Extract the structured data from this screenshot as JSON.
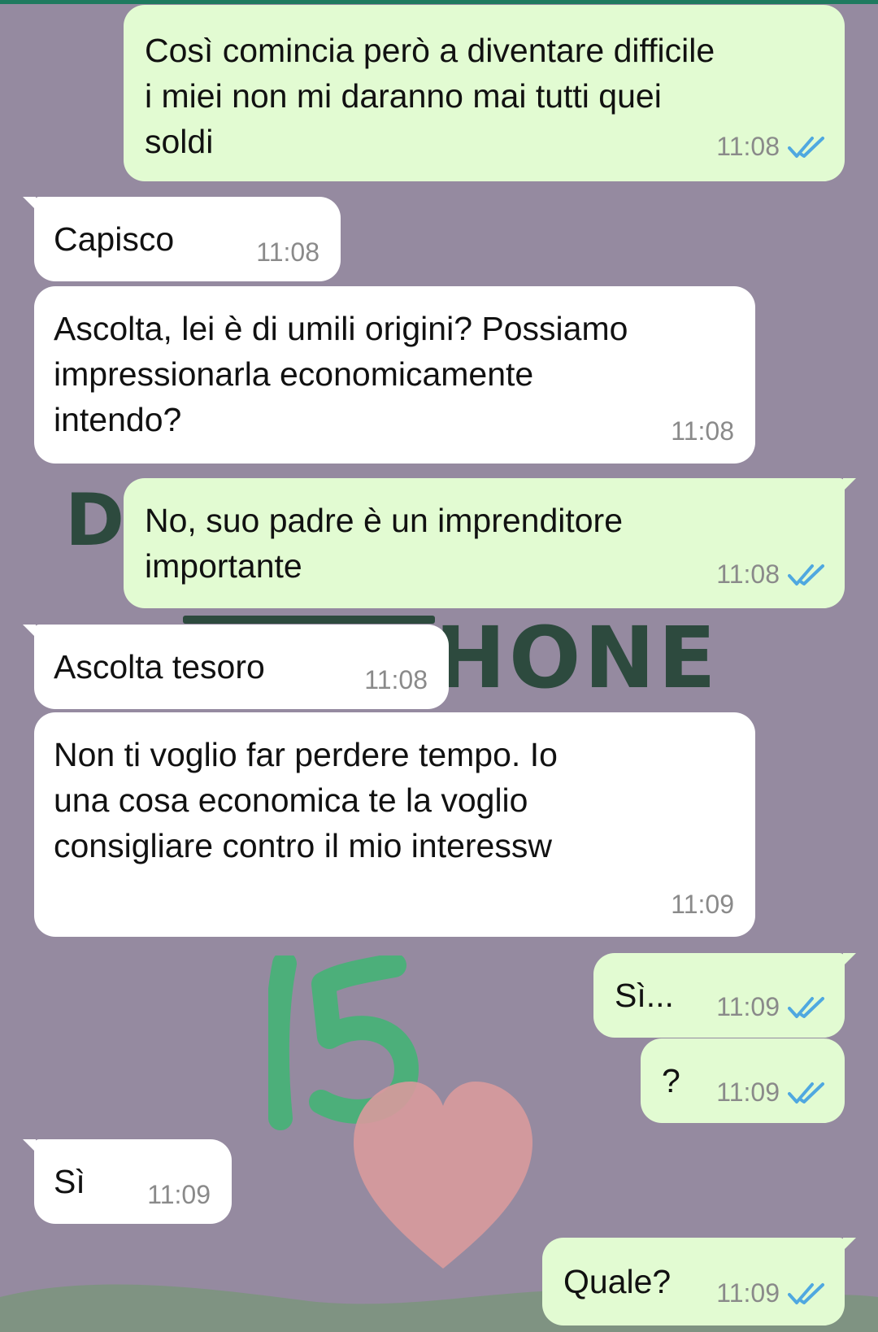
{
  "colors": {
    "wallpaper": "#958aa0",
    "incoming_bubble": "#ffffff",
    "outgoing_bubble": "#e2fbd2",
    "read_tick": "#4fa8e0",
    "timestamp": "#8a8a8a",
    "wallpaper_text": "#2d4a3e",
    "sticker_green": "#4caf7a",
    "heart_pink": "#d89a9c"
  },
  "wallpaper": {
    "letter": "D",
    "word": "HONE"
  },
  "messages": [
    {
      "direction": "outgoing",
      "lines": [
        "Così comincia però a diventare difficile",
        "i miei non mi daranno mai tutti quei",
        "soldi"
      ],
      "time": "11:08",
      "status": "read"
    },
    {
      "direction": "incoming",
      "lines": [
        "Capisco"
      ],
      "time": "11:08"
    },
    {
      "direction": "incoming",
      "lines": [
        "Ascolta, lei è di umili origini? Possiamo",
        "impressionarla economicamente",
        "intendo?"
      ],
      "time": "11:08"
    },
    {
      "direction": "outgoing",
      "lines": [
        "No, suo padre è un imprenditore",
        "importante"
      ],
      "time": "11:08",
      "status": "read"
    },
    {
      "direction": "incoming",
      "lines": [
        "Ascolta tesoro"
      ],
      "time": "11:08"
    },
    {
      "direction": "incoming",
      "lines": [
        "Non ti voglio far perdere tempo. Io",
        "una cosa economica te la voglio",
        "consigliare contro il mio interessw"
      ],
      "time": "11:09"
    },
    {
      "direction": "outgoing",
      "lines": [
        "Sì..."
      ],
      "time": "11:09",
      "status": "read"
    },
    {
      "direction": "outgoing",
      "lines": [
        "?"
      ],
      "time": "11:09",
      "status": "read"
    },
    {
      "direction": "incoming",
      "lines": [
        "Sì"
      ],
      "time": "11:09"
    },
    {
      "direction": "outgoing",
      "lines": [
        "Quale?"
      ],
      "time": "11:09",
      "status": "read"
    }
  ]
}
